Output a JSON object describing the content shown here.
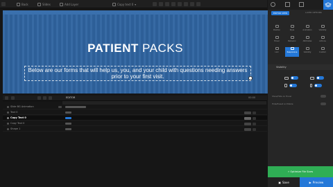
{
  "toolbar": {
    "items": [
      "Back",
      "Slides",
      "Add Layer"
    ],
    "layer_name": "Copy text 0"
  },
  "canvas": {
    "title_bold": "PATIENT",
    "title_light": "PACKS",
    "subtitle": "Below are our forms that will help us, you, and your child with questions needing answers prior to your first visit."
  },
  "timeline": {
    "editor_label": "EDITOR",
    "time": "00:00",
    "rows": [
      {
        "label": "Slide BG Animation"
      },
      {
        "label": "Text 0"
      },
      {
        "label": "Copy Text 0"
      },
      {
        "label": "Copy Text 0"
      },
      {
        "label": "Shape 1"
      }
    ]
  },
  "panel": {
    "editor_view": "EDITOR VIEW",
    "layer_options": "LAYER OPTIONS",
    "cells": [
      "Position",
      "Style",
      "Animation",
      "Visibility",
      "Hover",
      "Behavior",
      "Attributes",
      "Actions",
      "Link",
      "Responsive",
      "Visibility",
      "Custom"
    ],
    "visibility_header": "Visibility",
    "options": [
      "Show/Hide on Hover",
      "Hide/Preset on Mobile"
    ],
    "publish_label": "Optimize File Sizes",
    "save_label": "Save",
    "preview_label": "Preview"
  },
  "colors": {
    "accent": "#2478d8",
    "canvas_bg": "#2f64a0",
    "publish_green": "#2fae55"
  }
}
